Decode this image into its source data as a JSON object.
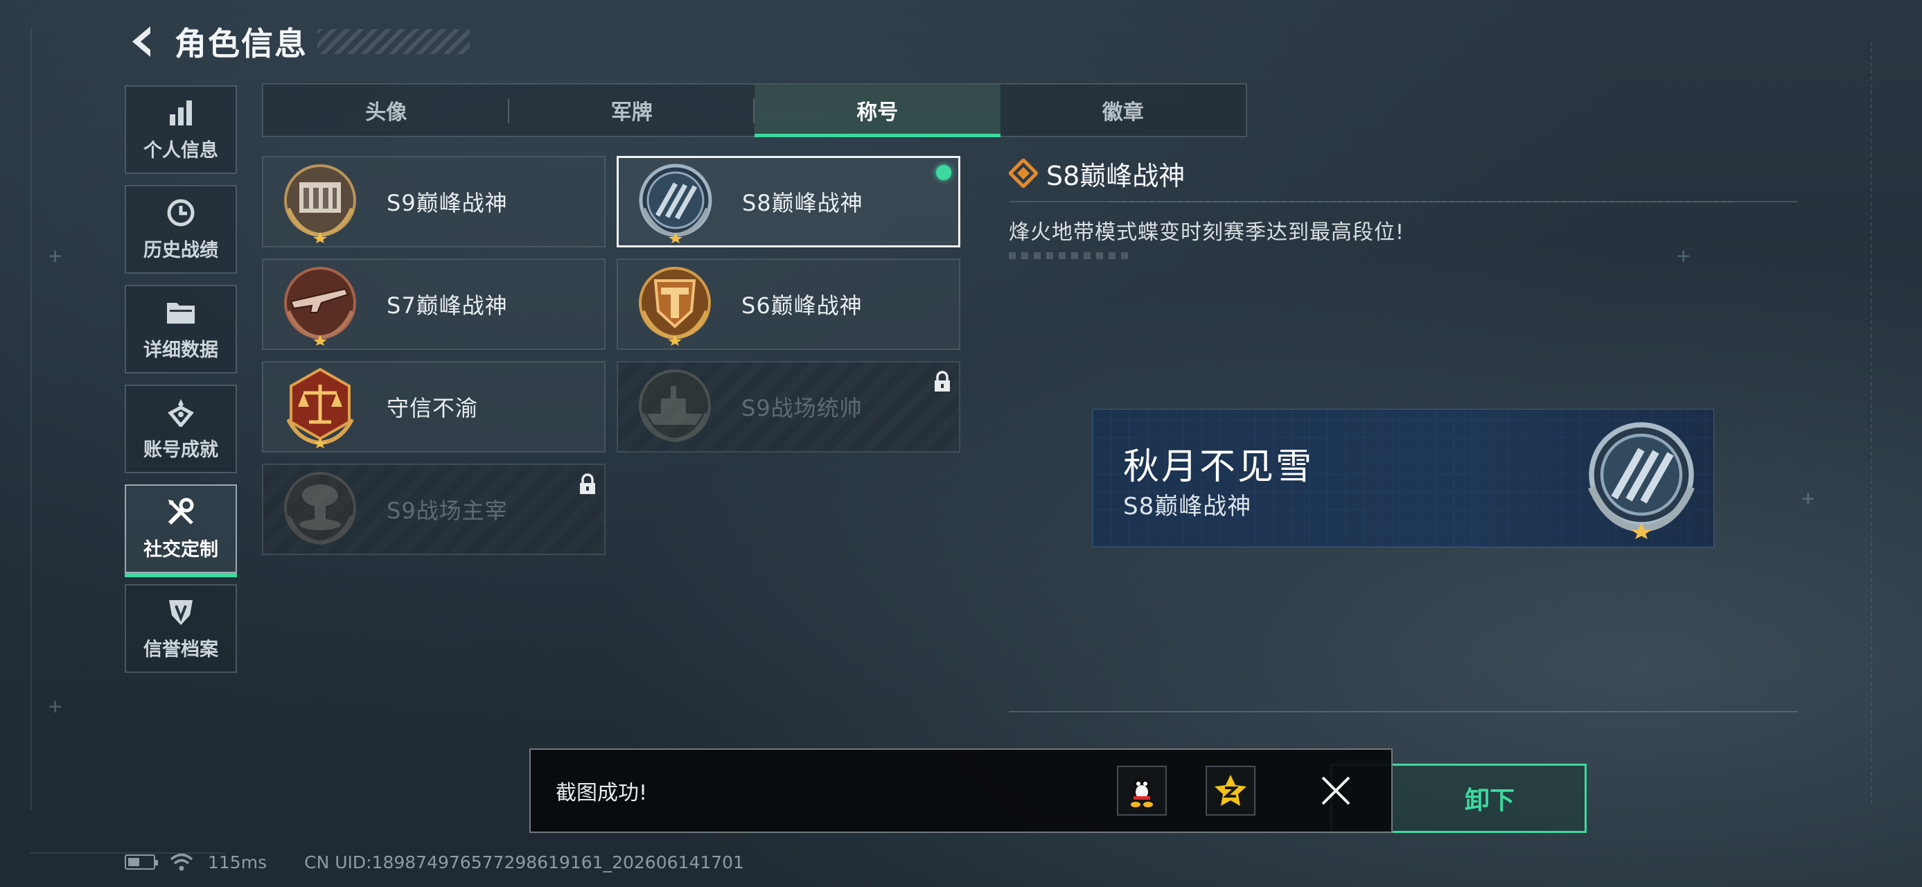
{
  "header": {
    "title": "角色信息"
  },
  "sidebar": {
    "items": [
      {
        "label": "个人信息",
        "icon": "bar-chart-icon"
      },
      {
        "label": "历史战绩",
        "icon": "history-clock-icon"
      },
      {
        "label": "详细数据",
        "icon": "folder-icon"
      },
      {
        "label": "账号成就",
        "icon": "achievement-icon"
      },
      {
        "label": "社交定制",
        "icon": "tools-icon",
        "active": true
      },
      {
        "label": "信誉档案",
        "icon": "credit-shield-icon"
      }
    ]
  },
  "tabs": [
    {
      "label": "头像"
    },
    {
      "label": "军牌"
    },
    {
      "label": "称号",
      "active": true
    },
    {
      "label": "徽章"
    }
  ],
  "titles": [
    {
      "name": "S9巅峰战神",
      "medal": "building-medal-icon"
    },
    {
      "name": "S8巅峰战神",
      "medal": "s8-emblem-icon",
      "selected": true,
      "equipped": true
    },
    {
      "name": "S7巅峰战神",
      "medal": "rifle-medal-icon"
    },
    {
      "name": "S6巅峰战神",
      "medal": "t-shield-medal-icon"
    },
    {
      "name": "守信不渝",
      "medal": "scales-medal-icon"
    },
    {
      "name": "S9战场统帅",
      "medal": "warship-medal-icon",
      "locked": true
    },
    {
      "name": "S9战场主宰",
      "medal": "mushroom-cloud-medal-icon",
      "locked": true
    }
  ],
  "detail": {
    "title": "S8巅峰战神",
    "description": "烽火地带模式蝶变时刻赛季达到最高段位!"
  },
  "preview": {
    "player_name": "秋月不见雪",
    "title": "S8巅峰战神"
  },
  "unequip_button": {
    "label": "卸下"
  },
  "toast": {
    "message": "截图成功!"
  },
  "status": {
    "ping": "115ms",
    "uid": "CN UID:18987497657729861916​1_202606141701"
  },
  "colors": {
    "accent": "#3ed9a0",
    "background": "#222e38"
  }
}
